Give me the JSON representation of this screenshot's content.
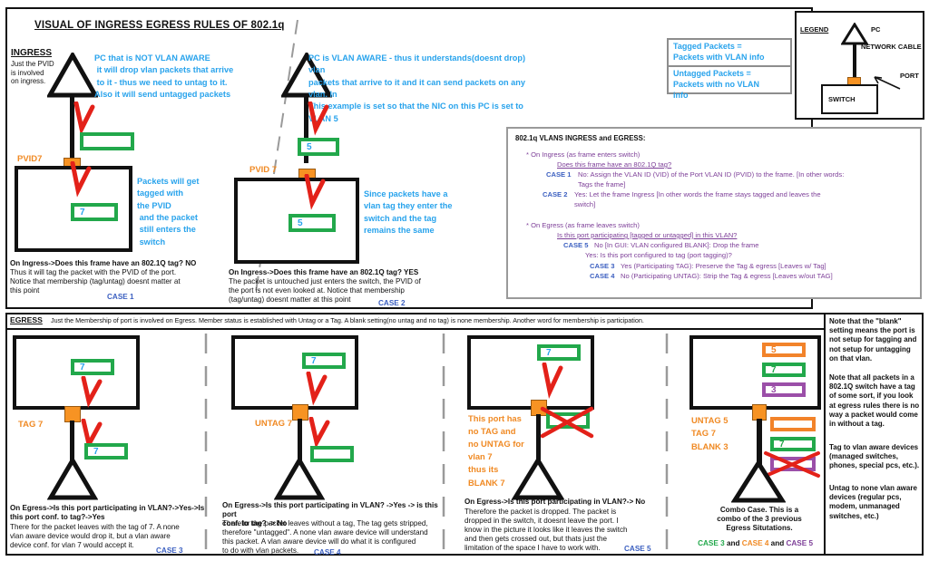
{
  "title": "VISUAL OF INGRESS EGRESS RULES OF 802.1q",
  "ingress": {
    "heading": "INGRESS",
    "subtext": "Just the PVID\nis involved\non ingress.",
    "case1": {
      "pc_note": "PC that is NOT VLAN AWARE\n it will drop vlan packets that arrive\n to it - thus we need to untag to it.\nAlso it will send untagged packets",
      "port_label": "PVID7",
      "inside_note": "Packets will get\ntagged with\nthe PVID\n and the packet\n still enters the\n switch",
      "pkt_top": "",
      "pkt_inside": "7",
      "caption_bold": "On Ingress->Does this frame have an 802.1Q tag? NO",
      "caption": "Thus it will tag the packet with the PVID of the port.\nNotice that membership (tag/untag) doesnt matter at\nthis point",
      "case_label": "CASE 1"
    },
    "case2": {
      "pc_note": "PC is VLAN AWARE - thus it understands(doesnt drop) vlan\npackets that arrive to it and it can send packets on any vlan. In\nThis example is set so that the NIC on this PC is set to VLAN 5",
      "port_label": "PVID 7",
      "inside_note": "Since packets have a\nvlan tag they enter the\nswitch and the tag\nremains the same",
      "pkt_top": "5",
      "pkt_inside": "5",
      "caption_bold": "On Ingress->Does this frame have an 802.1Q tag? YES",
      "caption": "The packet is untouched just enters the switch, the PVID of\nthe port is not even looked at. Notice that membership\n(tag/untag) doesnt matter at this point",
      "case_label": "CASE 2"
    }
  },
  "tag_defs": {
    "tagged": "Tagged Packets =\nPackets with VLAN info",
    "untagged": "Untagged Packets =\nPackets with no VLAN\ninfo"
  },
  "legend": {
    "heading": "LEGEND",
    "pc": "PC",
    "cable": "NETWORK CABLE",
    "port": "PORT",
    "switch": "SWITCH"
  },
  "rules": {
    "title": "802.1q VLANS INGRESS and EGRESS:",
    "ingress_header": "* On Ingress (as frame enters switch)",
    "ingress_q": "Does this frame have an 802.1Q tag?",
    "ingress_case1_label": "CASE 1",
    "ingress_case1": "No: Assign the VLAN ID (VID) of the Port VLAN ID (PVID) to the frame. [In other words:\nTags the frame]",
    "ingress_case2_label": "CASE 2",
    "ingress_case2": "Yes: Let the frame Ingress [In other words the frame stays tagged and leaves the\nswitch]",
    "egress_header": "* On Egress (as frame leaves switch)",
    "egress_q": "Is this port participating [tagged or untagged] in this VLAN?",
    "egress_case5_label": "CASE 5",
    "egress_case5": "No [In GUI: VLAN configured BLANK]: Drop the frame",
    "egress_yes": "Yes: Is this port configured to tag (port tagging)?",
    "egress_case3_label": "CASE 3",
    "egress_case3": "Yes (Participating TAG): Preserve the Tag & egress [Leaves w/ Tag]",
    "egress_case4_label": "CASE 4",
    "egress_case4": "No (Participating UNTAG): Strip the Tag & egress [Leaves w/out TAG]"
  },
  "egress": {
    "heading": "EGRESS",
    "subtext": "Just the Membership of port is involved on Egress. Member status is established with Untag or a Tag. A blank setting(no untag and no tag) is none membership. Another word for membership is participation.",
    "case3": {
      "port_label": "TAG 7",
      "pkt_inside": "7",
      "pkt_out": "7",
      "caption_bold": "On Egress->Is this port participating in VLAN?->Yes->Is\nthis port conf. to tag?->Yes",
      "caption": "There for the packet leaves with the tag of 7. A none\nvlan aware device would drop it, but a vlan aware\ndevice conf. for vlan 7 would accept it.",
      "case_label": "CASE 3"
    },
    "case4": {
      "port_label": "UNTAG 7",
      "pkt_inside": "7",
      "pkt_out": "",
      "caption_bold": "On Egress->Is this port participating in VLAN? ->Yes -> is this port\nconf. to tag? -> No",
      "caption": "Therefor the packet leaves without a tag, The tag gets stripped,\ntherefore \"untagged\". A none vlan aware device will understand\nthis packet. A vlan aware device will do what it is configured\nto do with vlan packets.",
      "case_label": "CASE 4"
    },
    "case5": {
      "port_note": "This port has\nno TAG and\nno UNTAG for\nvlan 7\nthus its\nBLANK 7",
      "pkt_inside": "7",
      "pkt_out": "",
      "caption_bold": "On Egress->Is this port participating in VLAN?-> No",
      "caption": "Therefore the packet is dropped. The packet is\ndropped in the switch, it doesnt leave the port. I\nknow in the picture it looks like it leaves the switch\nand then gets crossed out, but thats just the\nlimitation of the space I have to work with.",
      "case_label": "CASE 5"
    },
    "combo": {
      "port_labels": "UNTAG 5\nTAG 7\nBLANK 3",
      "pkt_in_1": "5",
      "pkt_in_2": "7",
      "pkt_in_3": "3",
      "pkt_out_1": "",
      "pkt_out_2": "7",
      "pkt_out_3": "",
      "caption": "Combo Case. This is a\ncombo of the 3 previous\nEgress Situtations.",
      "case3_label": "CASE 3",
      "and1": " and ",
      "case4_label": "CASE 4",
      "and2": " and ",
      "case5_label": "CASE 5"
    }
  },
  "notes": {
    "n1": "Note that the \"blank\"\nsetting means the port is\nnot setup for tagging and\nnot setup for untagging\non that vlan.",
    "n2": "Note that all packets in a\n802.1Q switch have a tag\nof some sort, if you look\nat egress rules there is no\nway a packet would come\nin without a tag.",
    "n3": "Tag to vlan aware devices\n(managed switches,\nphones, special pcs, etc.).",
    "n4": "Untag to none vlan aware\ndevices (regular pcs,\nmodem, unmanaged\nswitches, etc.)"
  },
  "colors": {
    "blue": "#28a3ec",
    "orange": "#f08a24",
    "green": "#22a84b",
    "purple": "#9b4fa8",
    "red": "#e32119",
    "case_blue": "#3b5fc0"
  }
}
